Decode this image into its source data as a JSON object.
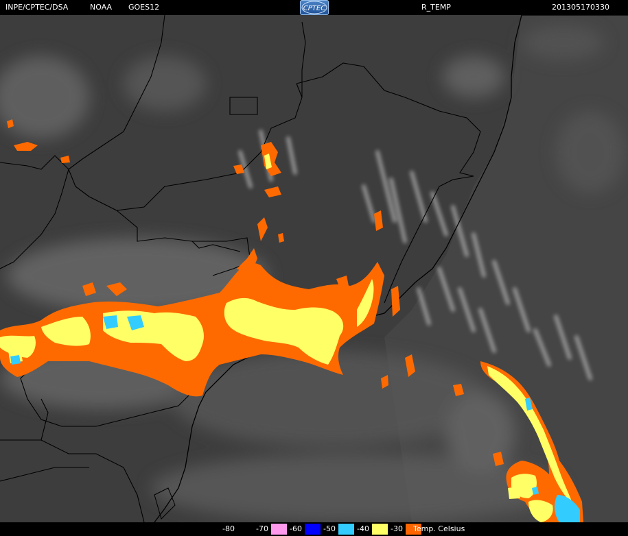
{
  "header": {
    "institution": "INPE/CPTEC/DSA",
    "agency": "NOAA",
    "satellite": "GOES12",
    "product": "R_TEMP",
    "timestamp": "201305170330",
    "logo_text": "CPTEC"
  },
  "legend": {
    "items": [
      {
        "label": "-80",
        "color": "#000000"
      },
      {
        "label": "-70",
        "color": "#ff99ee"
      },
      {
        "label": "-60",
        "color": "#0000ff"
      },
      {
        "label": "-50",
        "color": "#33ccff"
      },
      {
        "label": "-40",
        "color": "#ffff66"
      },
      {
        "label": "-30",
        "color": "#ff6600"
      }
    ],
    "unit": "Temp. Celsius"
  },
  "colors": {
    "background_land": "#3c3c3c",
    "background_ocean": "#4a4a4a",
    "border_lines": "#000000",
    "cloud_gray": "#9a9a9a"
  }
}
